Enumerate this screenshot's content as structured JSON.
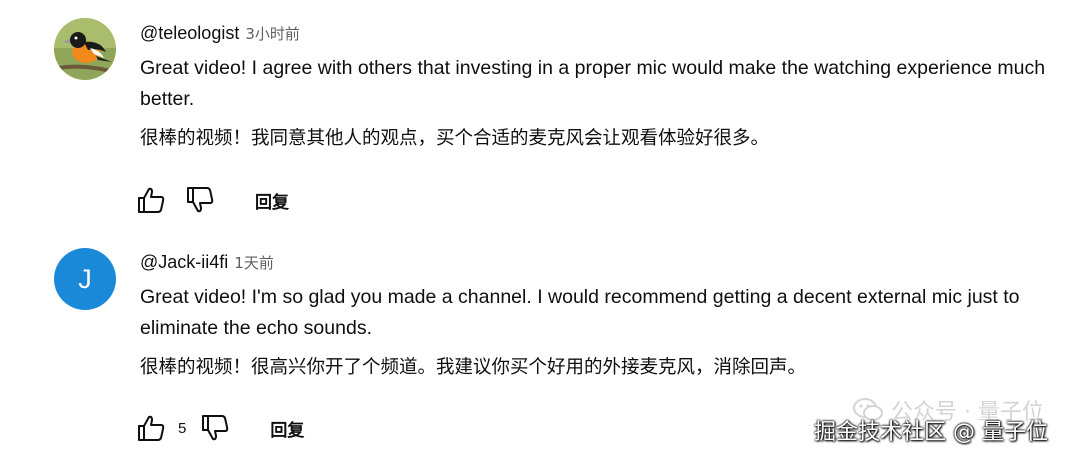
{
  "comments": [
    {
      "handle": "@teleologist",
      "time": "3小时前",
      "avatar_icon": "oriole-bird-avatar",
      "text_en": "Great video! I agree with others that investing in a proper mic would make the watching experience much better.",
      "text_zh": "很棒的视频！我同意其他人的观点，买个合适的麦克风会让观看体验好很多。",
      "like_count": "",
      "reply_label": "回复"
    },
    {
      "handle": "@Jack-ii4fi",
      "time": "1天前",
      "avatar_letter": "J",
      "avatar_color": "#1a8ad8",
      "text_en": "Great video! I'm so glad you made a channel. I would recommend getting a decent external mic just to eliminate the echo sounds.",
      "text_zh": "很棒的视频！很高兴你开了个频道。我建议你买个好用的外接麦克风，消除回声。",
      "like_count": "5",
      "reply_label": "回复"
    }
  ],
  "watermark": {
    "line1": "公众号 · 量子位",
    "line2": "掘金技术社区 @ 量子位"
  }
}
